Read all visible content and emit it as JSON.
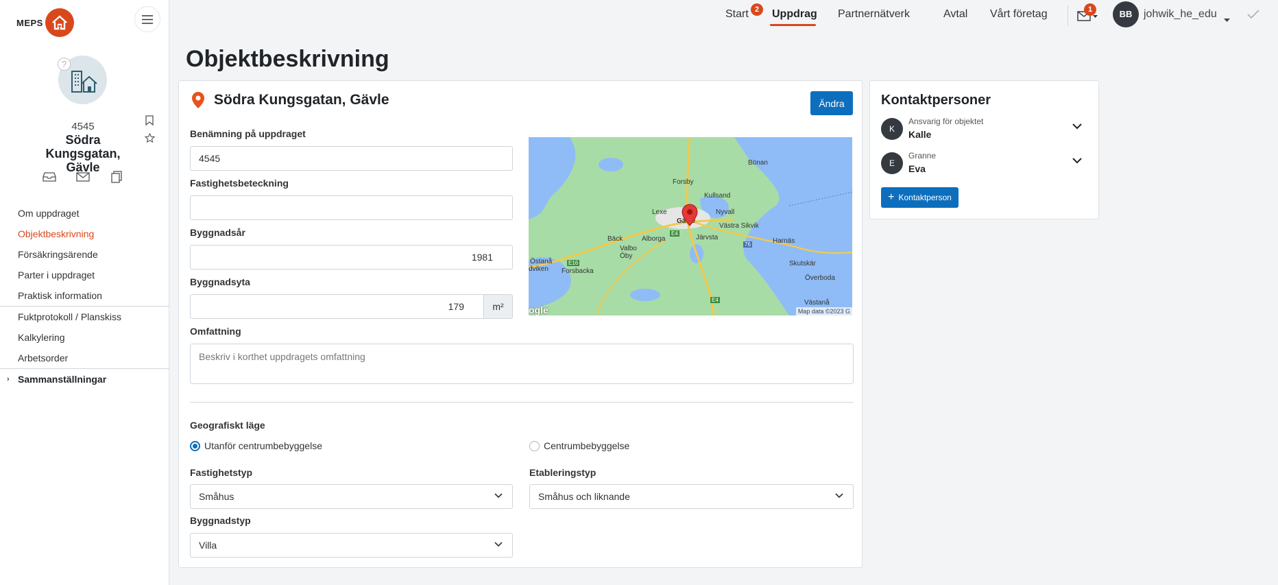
{
  "brand": {
    "name": "MEPS"
  },
  "sidebar": {
    "object_id": "4545",
    "object_name": "Södra Kungsgatan, Gävle",
    "help_mark": "?",
    "items": [
      {
        "label": "Om uppdraget"
      },
      {
        "label": "Objektbeskrivning",
        "active": true
      },
      {
        "label": "Försäkringsärende"
      },
      {
        "label": "Parter i uppdraget"
      },
      {
        "label": "Praktisk information"
      },
      {
        "label": "Fuktprotokoll / Planskiss"
      },
      {
        "label": "Kalkylering"
      },
      {
        "label": "Arbetsorder"
      }
    ],
    "group": {
      "label": "Sammanställningar",
      "caret": "›"
    }
  },
  "topnav": {
    "start": "Start",
    "start_badge": "2",
    "uppdrag": "Uppdrag",
    "partner": "Partnernätverk",
    "avtal": "Avtal",
    "foretag": "Vårt företag",
    "mail_badge": "1",
    "user_initials": "BB",
    "username": "johwik_he_edu"
  },
  "page": {
    "title": "Objektbeskrivning"
  },
  "object": {
    "address": "Södra Kungsgatan, Gävle",
    "edit_button": "Ändra",
    "name_label": "Benämning på uppdraget",
    "name_value": "4545",
    "property_label": "Fastighetsbeteckning",
    "property_value": "",
    "year_label": "Byggnadsår",
    "year_value": "1981",
    "area_label": "Byggnadsyta",
    "area_value": "179",
    "area_unit": "m²",
    "scope_label": "Omfattning",
    "scope_placeholder": "Beskriv i korthet uppdragets omfattning",
    "geo_label": "Geografiskt läge",
    "geo_option_outside": "Utanför centrumbebyggelse",
    "geo_option_center": "Centrumbebyggelse",
    "property_type_label": "Fastighetstyp",
    "property_type_value": "Småhus",
    "establishment_label": "Etableringstyp",
    "establishment_value": "Småhus och liknande",
    "building_type_label": "Byggnadstyp",
    "building_type_value": "Villa"
  },
  "map": {
    "labels": [
      "Bönan",
      "Forsby",
      "Kullsand",
      "Lexe",
      "Gävle",
      "Nyvall",
      "Västra Sikvik",
      "Bäck",
      "Alborga",
      "Järvsta",
      "Harnäs",
      "Valbo",
      "Öby",
      "Östanå",
      "Forsbacka",
      "Skutskär",
      "Överboda",
      "Västanå",
      "dviken"
    ],
    "road_labels": [
      "E4",
      "E16",
      "76",
      "E4"
    ],
    "attribution": "Map data ©2023 G",
    "logo": "ogle"
  },
  "contacts": {
    "title": "Kontaktpersoner",
    "people": [
      {
        "initial": "K",
        "role": "Ansvarig för objektet",
        "name": "Kalle"
      },
      {
        "initial": "E",
        "role": "Granne",
        "name": "Eva"
      }
    ],
    "add_button": "Kontaktperson"
  }
}
